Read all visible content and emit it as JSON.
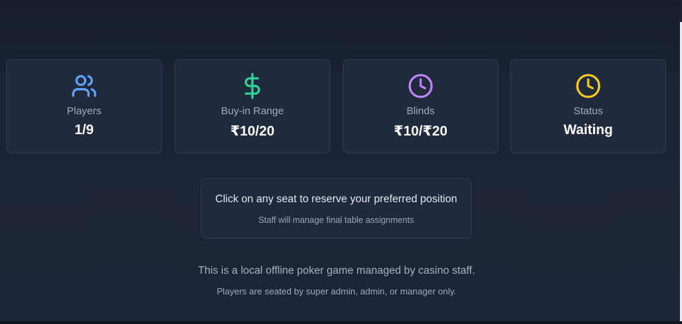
{
  "stats": [
    {
      "icon": "users-icon",
      "label": "Players",
      "value": "1/9",
      "color": "#60a5fa"
    },
    {
      "icon": "dollar-sign-icon",
      "label": "Buy-in Range",
      "value": "₹10/20",
      "color": "#34d399"
    },
    {
      "icon": "clock-icon",
      "label": "Blinds",
      "value": "₹10/₹20",
      "color": "#c084fc"
    },
    {
      "icon": "clock-icon",
      "label": "Status",
      "value": "Waiting",
      "color": "#facc15"
    }
  ],
  "notice": {
    "title": "Click on any seat to reserve your preferred position",
    "subtitle": "Staff will manage final table assignments"
  },
  "footer": {
    "line1": "This is a local offline poker game managed by casino staff.",
    "line2": "Players are seated by super admin, admin, or manager only."
  },
  "colors": {
    "background": "#1a2233",
    "card": "#1f2a3d",
    "border": "#2f3b50"
  }
}
